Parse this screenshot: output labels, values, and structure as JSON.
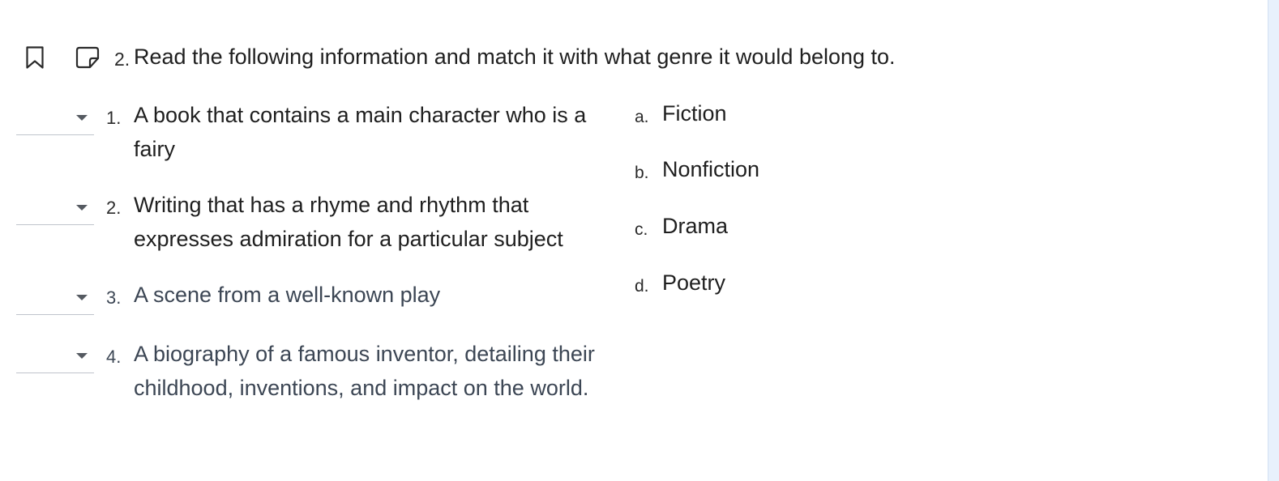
{
  "question": {
    "number": "2.",
    "prompt": "Read the following information and match it with what genre it would belong to."
  },
  "items": [
    {
      "number": "1.",
      "text": "A book that contains a main character who is a fairy",
      "selected": ""
    },
    {
      "number": "2.",
      "text": "Writing that has a rhyme and rhythm that expresses admiration for a particular subject",
      "selected": ""
    },
    {
      "number": "3.",
      "text": "A scene from a well-known play",
      "selected": ""
    },
    {
      "number": "4.",
      "text": "A biography of a famous inventor, detailing their childhood, inventions, and impact on the world.",
      "selected": ""
    }
  ],
  "options": [
    {
      "letter": "a.",
      "text": "Fiction"
    },
    {
      "letter": "b.",
      "text": "Nonfiction"
    },
    {
      "letter": "c.",
      "text": "Drama"
    },
    {
      "letter": "d.",
      "text": "Poetry"
    }
  ],
  "icons": {
    "bookmark": "bookmark-icon",
    "note": "note-icon",
    "dropdown": "chevron-down-icon"
  }
}
